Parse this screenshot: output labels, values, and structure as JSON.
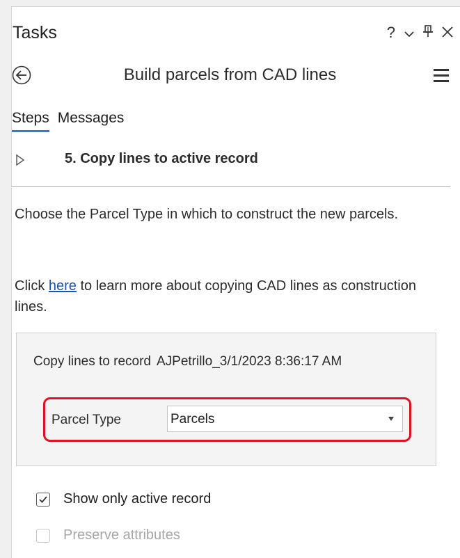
{
  "pane": {
    "title": "Tasks",
    "controls": {
      "help": "?",
      "dropdown": "⌄",
      "pin": "𝌆",
      "close": "✕"
    }
  },
  "task": {
    "name": "Build parcels from CAD lines"
  },
  "tabs": [
    {
      "label": "Steps",
      "active": true
    },
    {
      "label": "Messages",
      "active": false
    }
  ],
  "step": {
    "label": "5. Copy lines to active record"
  },
  "instructions": {
    "line1": "Choose the Parcel Type in which to construct the new parcels.",
    "link_prefix": "Click ",
    "link_text": "here",
    "link_suffix": " to learn more about copying CAD lines as construction lines."
  },
  "form": {
    "record_label": "Copy lines to record",
    "record_value": "AJPetrillo_3/1/2023 8:36:17 AM",
    "parcel_type_label": "Parcel Type",
    "parcel_type_value": "Parcels"
  },
  "options": [
    {
      "label": "Show only active record",
      "checked": true,
      "enabled": true
    },
    {
      "label": "Preserve attributes",
      "checked": false,
      "enabled": false
    }
  ],
  "colors": {
    "accent": "#2f7fd3",
    "highlight": "#e0121c",
    "link": "#1a56b0"
  }
}
